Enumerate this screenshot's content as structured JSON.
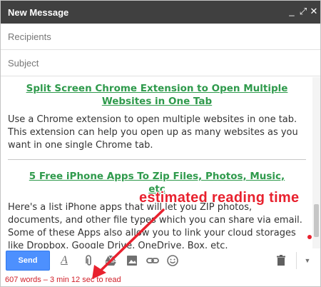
{
  "window": {
    "title": "New Message",
    "controls": {
      "minimize": "_",
      "popout": "⤢",
      "close": "✕"
    }
  },
  "recipients": {
    "placeholder": "Recipients"
  },
  "subject": {
    "placeholder": "Subject"
  },
  "articles": [
    {
      "title": "Split Screen Chrome Extension to Open Multiple Websites in One Tab",
      "text": "Use a Chrome extension to open multiple websites in one tab. This extension can help you open up as many websites as you want in one single Chrome tab."
    },
    {
      "title": "5 Free iPhone Apps To Zip Files, Photos, Music, etc",
      "text": "Here's a list iPhone apps that will let you ZIP photos, documents, and other file types which you can share via email. Some of these Apps also allow you to link your cloud storages like Dropbox, Google Drive, OneDrive, Box, etc."
    }
  ],
  "toolbar": {
    "send_label": "Send",
    "icons": [
      "format-text-icon",
      "attach-icon",
      "drive-icon",
      "photo-icon",
      "link-icon",
      "emoji-icon",
      "trash-icon",
      "more-options-icon"
    ]
  },
  "status": {
    "word_count": "607 words – 3 min 12 sec to read"
  },
  "annotation": {
    "text": "estimated reading time",
    "color": "#e8212e"
  },
  "colors": {
    "send": "#4d90fe",
    "title_link": "#2f9a4c",
    "titlebar": "#404040",
    "status_text": "#d0202a"
  }
}
